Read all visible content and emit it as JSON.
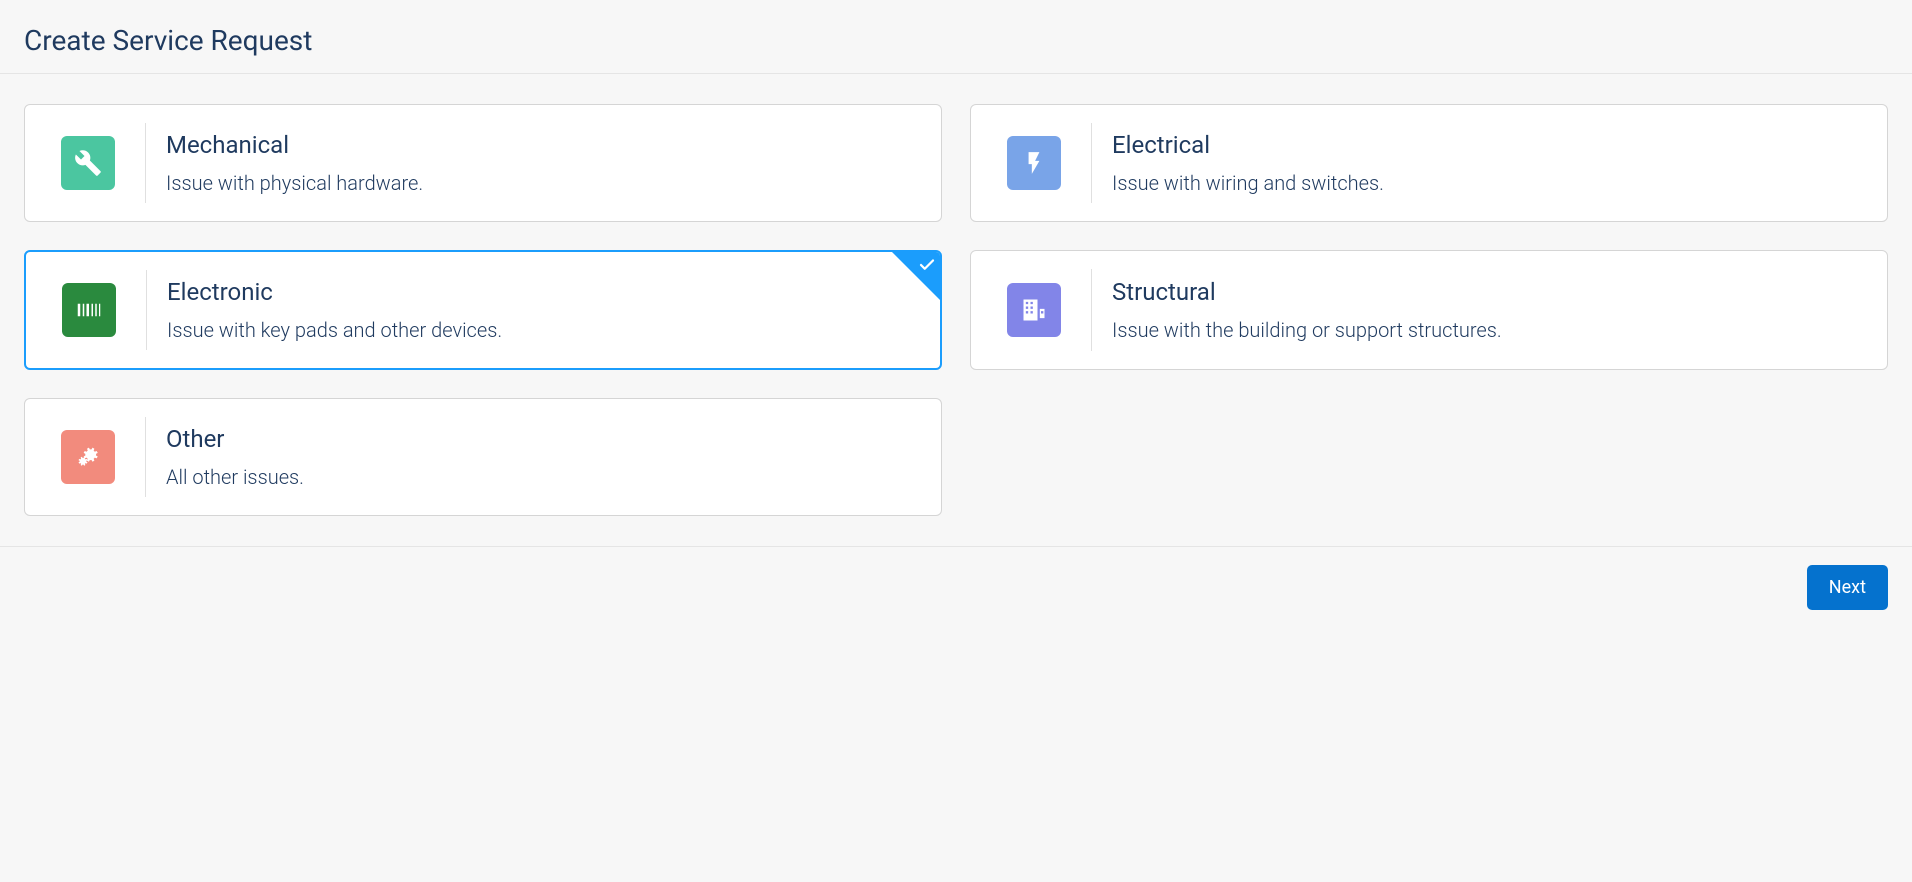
{
  "header": {
    "title": "Create Service Request"
  },
  "cards": [
    {
      "id": "mechanical",
      "title": "Mechanical",
      "desc": "Issue with physical hardware.",
      "icon": "wrench",
      "color": "teal",
      "selected": false
    },
    {
      "id": "electrical",
      "title": "Electrical",
      "desc": "Issue with wiring and switches.",
      "icon": "bolt",
      "color": "blue",
      "selected": false
    },
    {
      "id": "electronic",
      "title": "Electronic",
      "desc": "Issue with key pads and other devices.",
      "icon": "barcode",
      "color": "green",
      "selected": true
    },
    {
      "id": "structural",
      "title": "Structural",
      "desc": "Issue with the building or support structures.",
      "icon": "building",
      "color": "purple",
      "selected": false
    },
    {
      "id": "other",
      "title": "Other",
      "desc": "All other issues.",
      "icon": "gears",
      "color": "coral",
      "selected": false
    }
  ],
  "footer": {
    "next_label": "Next"
  }
}
